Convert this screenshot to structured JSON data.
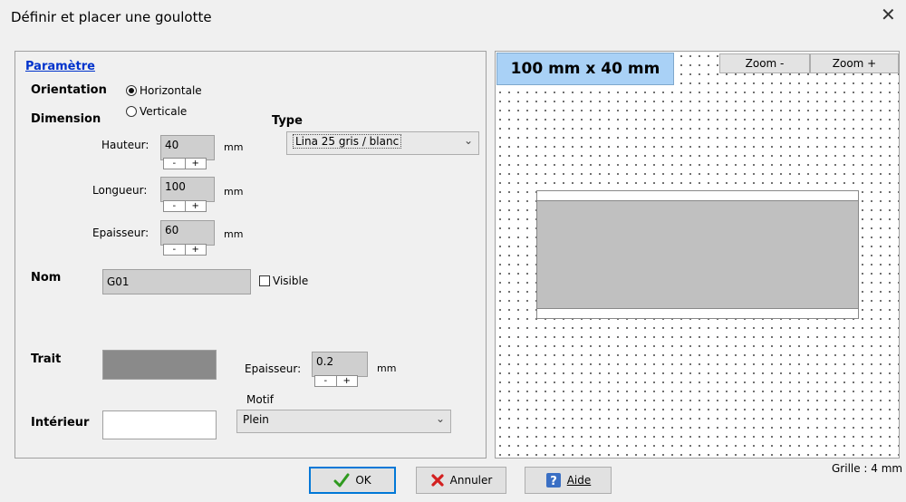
{
  "window": {
    "title": "Définir et placer une goulotte",
    "close_glyph": "✕"
  },
  "params": {
    "header": "Paramètre",
    "orientation_label": "Orientation",
    "orientation_options": [
      "Horizontale",
      "Verticale"
    ],
    "orientation_selected": "Horizontale",
    "dimension_label": "Dimension",
    "hauteur": {
      "label": "Hauteur:",
      "value": "40",
      "unit": "mm"
    },
    "longueur": {
      "label": "Longueur:",
      "value": "100",
      "unit": "mm"
    },
    "epaisseur": {
      "label": "Epaisseur:",
      "value": "60",
      "unit": "mm"
    },
    "spin_minus": "-",
    "spin_plus": "+",
    "type_label": "Type",
    "type_value": "Lina 25 gris / blanc",
    "nom_label": "Nom",
    "nom_value": "G01",
    "visible_label": "Visible",
    "visible_checked": false,
    "trait_label": "Trait",
    "trait_color": "#8a8a8a",
    "trait_epaisseur": {
      "label": "Epaisseur:",
      "value": "0.2",
      "unit": "mm"
    },
    "motif_label": "Motif",
    "interieur_label": "Intérieur",
    "interieur_color": "#ffffff",
    "motif_value": "Plein"
  },
  "preview": {
    "dimension_text": "100 mm x 40 mm",
    "zoom_minus": "Zoom -",
    "zoom_plus": "Zoom +",
    "grid_label": "Grille : 4 mm",
    "duct_color": "#c0c0c0",
    "dimension_bg": "#a9d1f6"
  },
  "buttons": {
    "ok": "OK",
    "cancel": "Annuler",
    "help": "Aide"
  },
  "icons": {
    "ok": "checkmark-icon",
    "cancel": "x-icon",
    "help": "help-icon"
  }
}
